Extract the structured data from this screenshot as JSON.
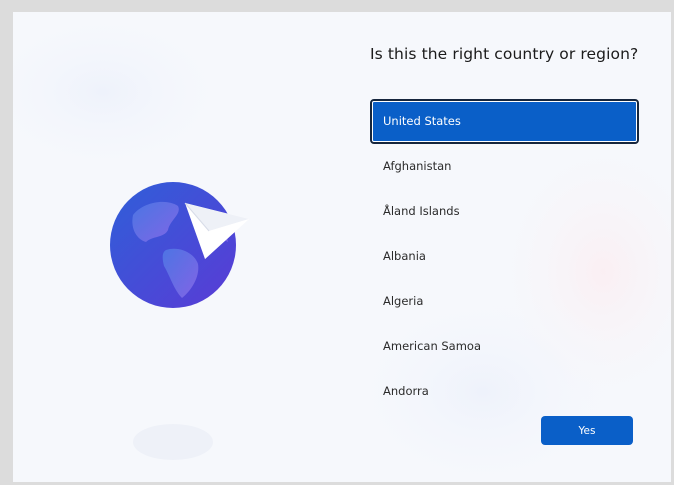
{
  "oobe": {
    "heading": "Is this the right country or region?",
    "countries": [
      {
        "label": "United States",
        "selected": true
      },
      {
        "label": "Afghanistan",
        "selected": false
      },
      {
        "label": "Åland Islands",
        "selected": false
      },
      {
        "label": "Albania",
        "selected": false
      },
      {
        "label": "Algeria",
        "selected": false
      },
      {
        "label": "American Samoa",
        "selected": false
      },
      {
        "label": "Andorra",
        "selected": false
      }
    ],
    "yes_label": "Yes"
  },
  "icons": {
    "hero": "globe-with-paper-plane-icon"
  },
  "colors": {
    "accent": "#0a5fc8",
    "background": "#f6f8fc",
    "globe_dark": "#2b49c9",
    "globe_light": "#7c62e8"
  }
}
